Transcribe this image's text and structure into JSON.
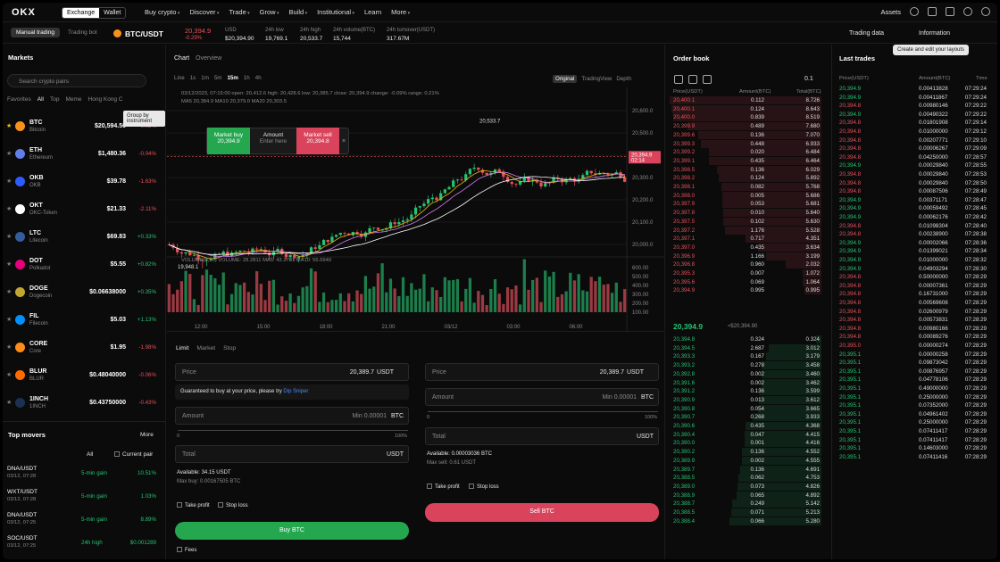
{
  "topbar": {
    "logo": "OKX",
    "segments": [
      "Exchange",
      "Wallet"
    ],
    "nav": [
      "Buy crypto",
      "Discover",
      "Trade",
      "Grow",
      "Build",
      "Institutional",
      "Learn",
      "More"
    ],
    "assets": "Assets"
  },
  "ticker": {
    "modes": [
      "Manual trading",
      "Trading bot"
    ],
    "pair": "BTC/USDT",
    "price": "20,394.9",
    "change": "-0.29%",
    "usd_label": "USD",
    "usd_value": "$20,394.90",
    "low_label": "24h low",
    "low": "19,769.1",
    "high_label": "24h high",
    "high": "20,533.7",
    "vol_label": "24h volume(BTC)",
    "vol": "15,744",
    "turn_label": "24h turnover(USDT)",
    "turn": "317.67M",
    "trading_data": "Trading data",
    "information": "Information",
    "tooltip": "Create and edit your layouts"
  },
  "markets": {
    "title": "Markets",
    "search_placeholder": "Search crypto pairs",
    "tabs": [
      "Favorites",
      "All",
      "Top",
      "Meme",
      "Hong Kong C"
    ],
    "tooltip": "Group by instrument",
    "rows": [
      {
        "sym": "BTC",
        "name": "Bitcoin",
        "price": "$20,594.50",
        "chg": "-0.02%",
        "up": false,
        "color": "#f7931a",
        "fav": true
      },
      {
        "sym": "ETH",
        "name": "Ethereum",
        "price": "$1,480.36",
        "chg": "-0.04%",
        "up": false,
        "color": "#627eea",
        "fav": false
      },
      {
        "sym": "OKB",
        "name": "OKB",
        "price": "$39.78",
        "chg": "-1.63%",
        "up": false,
        "color": "#2d5bff",
        "fav": false
      },
      {
        "sym": "OKT",
        "name": "OKC-Token",
        "price": "$21.33",
        "chg": "-2.11%",
        "up": false,
        "color": "#ffffff",
        "fav": false
      },
      {
        "sym": "LTC",
        "name": "Litecoin",
        "price": "$69.83",
        "chg": "+0.33%",
        "up": true,
        "color": "#345d9d",
        "fav": false
      },
      {
        "sym": "DOT",
        "name": "Polkadot",
        "price": "$5.55",
        "chg": "+0.82%",
        "up": true,
        "color": "#e6007a",
        "fav": false
      },
      {
        "sym": "DOGE",
        "name": "Dogecoin",
        "price": "$0.06638000",
        "chg": "+0.35%",
        "up": true,
        "color": "#c2a633",
        "fav": false
      },
      {
        "sym": "FIL",
        "name": "Filecoin",
        "price": "$5.03",
        "chg": "+1.13%",
        "up": true,
        "color": "#0090ff",
        "fav": false
      },
      {
        "sym": "CORE",
        "name": "Core",
        "price": "$1.95",
        "chg": "-1.98%",
        "up": false,
        "color": "#ff8c1a",
        "fav": false
      },
      {
        "sym": "BLUR",
        "name": "BLUR",
        "price": "$0.48040000",
        "chg": "-0.06%",
        "up": false,
        "color": "#ff6b00",
        "fav": false
      },
      {
        "sym": "1INCH",
        "name": "1INCH",
        "price": "$0.43750000",
        "chg": "-0.43%",
        "up": false,
        "color": "#1b314f",
        "fav": false
      }
    ]
  },
  "movers": {
    "title": "Top movers",
    "more": "More",
    "filter": "All",
    "current_pair": "Current pair",
    "rows": [
      {
        "pair": "DNA/USDT",
        "time": "03/12, 07:28",
        "tag": "5-min gain",
        "val": "10.51%"
      },
      {
        "pair": "WXT/USDT",
        "time": "03/12, 07:28",
        "tag": "5-min gain",
        "val": "1.03%"
      },
      {
        "pair": "DNA/USDT",
        "time": "03/12, 07:25",
        "tag": "5-min gain",
        "val": "8.89%"
      },
      {
        "pair": "SOC/USDT",
        "time": "03/12, 07:25",
        "tag": "24h high",
        "val": "$0.001289"
      }
    ]
  },
  "chart": {
    "tabs": [
      "Chart",
      "Overview"
    ],
    "intervals": [
      "Line",
      "1s",
      "1m",
      "5m",
      "15m",
      "1h",
      "4h"
    ],
    "views": [
      "Original",
      "TradingView",
      "Depth"
    ],
    "ohlc": "03/12/2023, 07:15:00  open: 20,412.6  high: 20,428.6  low: 20,385.7  close: 20,394.9  change: -0.09%  range: 0.21%",
    "ma": "MA5 20,384.9  MA10 20,379.0  MA20 20,303.5",
    "vol_label": "VOLUME(5,10)  VOLUME: 28.2811  MA5: 43.2701  MA10: 56.6940",
    "market_buy": "Market buy",
    "market_buy_px": "20,394.9",
    "amount": "Amount",
    "amount_ph": "Enter here",
    "market_sell": "Market sell",
    "market_sell_px": "20,394.8",
    "high_mark": "20,533.7",
    "low_mark": "19,948.1",
    "last_px": "20,394.9",
    "countdown": "02:14",
    "price_ticks": [
      "20,600.0",
      "20,500.0",
      "20,400.0",
      "20,300.0",
      "20,200.0",
      "20,100.0",
      "20,000.0"
    ],
    "vol_ticks": [
      "600.00",
      "500.00",
      "400.00",
      "300.00",
      "200.00",
      "100.00"
    ],
    "time_ticks": [
      "12:00",
      "15:00",
      "18:00",
      "21:00",
      "03/12",
      "03:00",
      "06:00"
    ]
  },
  "order": {
    "tabs": [
      "Limit",
      "Market",
      "Stop"
    ],
    "price": "Price",
    "price_val": "20,389.7",
    "ccy": "USDT",
    "banner": "Guaranteed to buy at your price, please try",
    "dip": "Dip Sniper",
    "amount": "Amount",
    "min_buy": "Min 0.00001",
    "btc": "BTC",
    "pct0": "0",
    "pct100": "100%",
    "total": "Total",
    "avail_buy": "Available: 34.15 USDT",
    "max_buy": "Max buy: 0.00167505 BTC",
    "take_profit": "Take profit",
    "stop_loss": "Stop loss",
    "buy": "Buy BTC",
    "fees": "Fees",
    "avail_sell": "Available: 0.00003036 BTC",
    "max_sell": "Max sell: 0.61 USDT",
    "sell": "Sell BTC"
  },
  "orderbook": {
    "title": "Order book",
    "step": "0.1",
    "h_price": "Price(USDT)",
    "h_amt": "Amount(BTC)",
    "h_tot": "Total(BTC)",
    "mid": "20,394.9",
    "mid_usd": "≈$20,394.90",
    "asks": [
      [
        "20,400.1",
        "0.112",
        "8.726"
      ],
      [
        "20,400.1",
        "0.124",
        "8.643"
      ],
      [
        "20,400.0",
        "0.839",
        "8.519"
      ],
      [
        "20,399.9",
        "0.489",
        "7.680"
      ],
      [
        "20,399.6",
        "0.136",
        "7.070"
      ],
      [
        "20,399.3",
        "0.448",
        "6.933"
      ],
      [
        "20,399.2",
        "0.020",
        "6.484"
      ],
      [
        "20,399.1",
        "0.435",
        "6.464"
      ],
      [
        "20,398.5",
        "0.136",
        "6.029"
      ],
      [
        "20,398.2",
        "0.124",
        "5.892"
      ],
      [
        "20,398.1",
        "0.082",
        "5.768"
      ],
      [
        "20,398.0",
        "0.005",
        "5.686"
      ],
      [
        "20,397.9",
        "0.053",
        "5.681"
      ],
      [
        "20,397.8",
        "0.010",
        "5.640"
      ],
      [
        "20,397.5",
        "0.102",
        "5.630"
      ],
      [
        "20,397.2",
        "1.176",
        "5.528"
      ],
      [
        "20,397.1",
        "0.717",
        "4.351"
      ],
      [
        "20,397.0",
        "0.435",
        "3.634"
      ],
      [
        "20,396.9",
        "1.166",
        "3.199"
      ],
      [
        "20,396.8",
        "0.960",
        "2.032"
      ],
      [
        "20,395.3",
        "0.007",
        "1.072"
      ],
      [
        "20,395.6",
        "0.069",
        "1.064"
      ],
      [
        "20,394.9",
        "0.995",
        "0.995"
      ]
    ],
    "bids": [
      [
        "20,394.8",
        "0.324",
        "0.324"
      ],
      [
        "20,394.5",
        "2.687",
        "3.012"
      ],
      [
        "20,393.3",
        "0.167",
        "3.179"
      ],
      [
        "20,393.2",
        "0.278",
        "3.458"
      ],
      [
        "20,392.8",
        "0.002",
        "3.460"
      ],
      [
        "20,391.6",
        "0.002",
        "3.462"
      ],
      [
        "20,391.2",
        "0.136",
        "3.599"
      ],
      [
        "20,390.9",
        "0.013",
        "3.612"
      ],
      [
        "20,390.8",
        "0.054",
        "3.665"
      ],
      [
        "20,390.7",
        "0.268",
        "3.933"
      ],
      [
        "20,390.6",
        "0.435",
        "4.368"
      ],
      [
        "20,390.4",
        "0.047",
        "4.415"
      ],
      [
        "20,390.0",
        "0.001",
        "4.416"
      ],
      [
        "20,390.2",
        "0.136",
        "4.552"
      ],
      [
        "20,389.9",
        "0.002",
        "4.555"
      ],
      [
        "20,389.7",
        "0.136",
        "4.691"
      ],
      [
        "20,388.5",
        "0.062",
        "4.753"
      ],
      [
        "20,389.0",
        "0.073",
        "4.826"
      ],
      [
        "20,388.9",
        "0.065",
        "4.892"
      ],
      [
        "20,388.7",
        "0.249",
        "5.142"
      ],
      [
        "20,388.5",
        "0.071",
        "5.213"
      ],
      [
        "20,388.4",
        "0.066",
        "5.280"
      ]
    ]
  },
  "trades": {
    "title": "Last trades",
    "h_price": "Price(USDT)",
    "h_amt": "Amount(BTC)",
    "h_time": "Time",
    "rows": [
      [
        "20,394.9",
        "0.00413828",
        "07:29:24",
        true
      ],
      [
        "20,394.9",
        "0.00411867",
        "07:29:24",
        true
      ],
      [
        "20,394.8",
        "0.00980146",
        "07:29:22",
        false
      ],
      [
        "20,394.9",
        "0.00490322",
        "07:29:22",
        true
      ],
      [
        "20,394.8",
        "0.01801908",
        "07:29:14",
        false
      ],
      [
        "20,394.8",
        "0.01000000",
        "07:29:12",
        false
      ],
      [
        "20,394.8",
        "0.00207771",
        "07:29:10",
        false
      ],
      [
        "20,394.8",
        "0.00006267",
        "07:29:09",
        false
      ],
      [
        "20,394.8",
        "0.04250000",
        "07:28:57",
        false
      ],
      [
        "20,394.9",
        "0.00029840",
        "07:28:55",
        true
      ],
      [
        "20,394.8",
        "0.00029840",
        "07:28:53",
        false
      ],
      [
        "20,394.8",
        "0.00029840",
        "07:28:50",
        false
      ],
      [
        "20,394.8",
        "0.00087506",
        "07:28:49",
        false
      ],
      [
        "20,394.9",
        "0.00371171",
        "07:28:47",
        true
      ],
      [
        "20,394.9",
        "0.00059492",
        "07:28:45",
        true
      ],
      [
        "20,394.9",
        "0.00062176",
        "07:28:42",
        true
      ],
      [
        "20,394.8",
        "0.01098304",
        "07:28:40",
        false
      ],
      [
        "20,394.8",
        "0.00238900",
        "07:28:38",
        false
      ],
      [
        "20,394.9",
        "0.00002066",
        "07:28:36",
        true
      ],
      [
        "20,394.9",
        "0.01399021",
        "07:28:34",
        true
      ],
      [
        "20,394.9",
        "0.01000000",
        "07:28:32",
        true
      ],
      [
        "20,394.9",
        "0.04903294",
        "07:28:30",
        true
      ],
      [
        "20,394.8",
        "0.50000000",
        "07:28:29",
        false
      ],
      [
        "20,394.8",
        "0.00007361",
        "07:28:29",
        false
      ],
      [
        "20,394.8",
        "0.16731000",
        "07:28:29",
        false
      ],
      [
        "20,394.8",
        "0.00569608",
        "07:28:29",
        false
      ],
      [
        "20,394.8",
        "0.02600979",
        "07:28:29",
        false
      ],
      [
        "20,394.8",
        "0.00573831",
        "07:28:29",
        false
      ],
      [
        "20,394.8",
        "0.00980166",
        "07:28:29",
        false
      ],
      [
        "20,394.8",
        "0.00089276",
        "07:28:29",
        false
      ],
      [
        "20,395.0",
        "0.00000274",
        "07:28:29",
        false
      ],
      [
        "20,395.1",
        "0.00000258",
        "07:28:29",
        true
      ],
      [
        "20,395.1",
        "0.09873042",
        "07:28:29",
        true
      ],
      [
        "20,395.1",
        "0.00876957",
        "07:28:29",
        true
      ],
      [
        "20,395.1",
        "0.04778106",
        "07:28:29",
        true
      ],
      [
        "20,395.1",
        "0.49000000",
        "07:28:29",
        true
      ],
      [
        "20,395.1",
        "0.25000000",
        "07:28:29",
        true
      ],
      [
        "20,395.1",
        "0.07352000",
        "07:28:29",
        true
      ],
      [
        "20,395.1",
        "0.04961402",
        "07:28:29",
        true
      ],
      [
        "20,395.1",
        "0.25000000",
        "07:28:29",
        true
      ],
      [
        "20,395.1",
        "0.07411417",
        "07:28:29",
        true
      ],
      [
        "20,395.1",
        "0.07411417",
        "07:28:29",
        true
      ],
      [
        "20,395.1",
        "0.14603000",
        "07:28:29",
        true
      ],
      [
        "20,395.1",
        "0.07411416",
        "07:28:29",
        true
      ]
    ]
  }
}
